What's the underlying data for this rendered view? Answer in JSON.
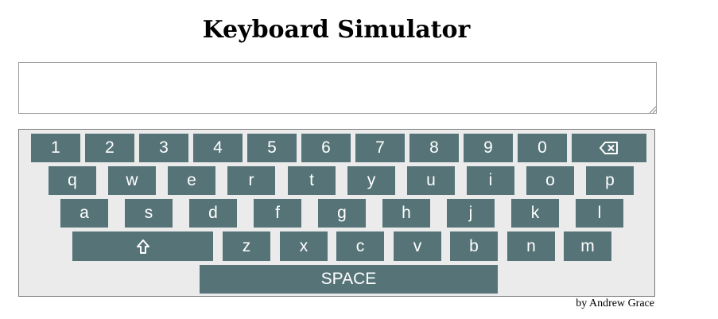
{
  "page": {
    "title": "Keyboard Simulator",
    "credit": "by Andrew Grace"
  },
  "text_area": {
    "value": "",
    "placeholder": ""
  },
  "keyboard": {
    "number_row": [
      "1",
      "2",
      "3",
      "4",
      "5",
      "6",
      "7",
      "8",
      "9",
      "0"
    ],
    "top_row": [
      "q",
      "w",
      "e",
      "r",
      "t",
      "y",
      "u",
      "i",
      "o",
      "p"
    ],
    "home_row": [
      "a",
      "s",
      "d",
      "f",
      "g",
      "h",
      "j",
      "k",
      "l"
    ],
    "bottom_row": [
      "z",
      "x",
      "c",
      "v",
      "b",
      "n",
      "m"
    ],
    "backspace_icon": "backspace-icon",
    "shift_icon": "shift-arrow-icon",
    "space_label": "SPACE"
  },
  "colors": {
    "key_background": "#567478",
    "key_text": "#ffffff",
    "keyboard_background": "#ebebeb"
  }
}
